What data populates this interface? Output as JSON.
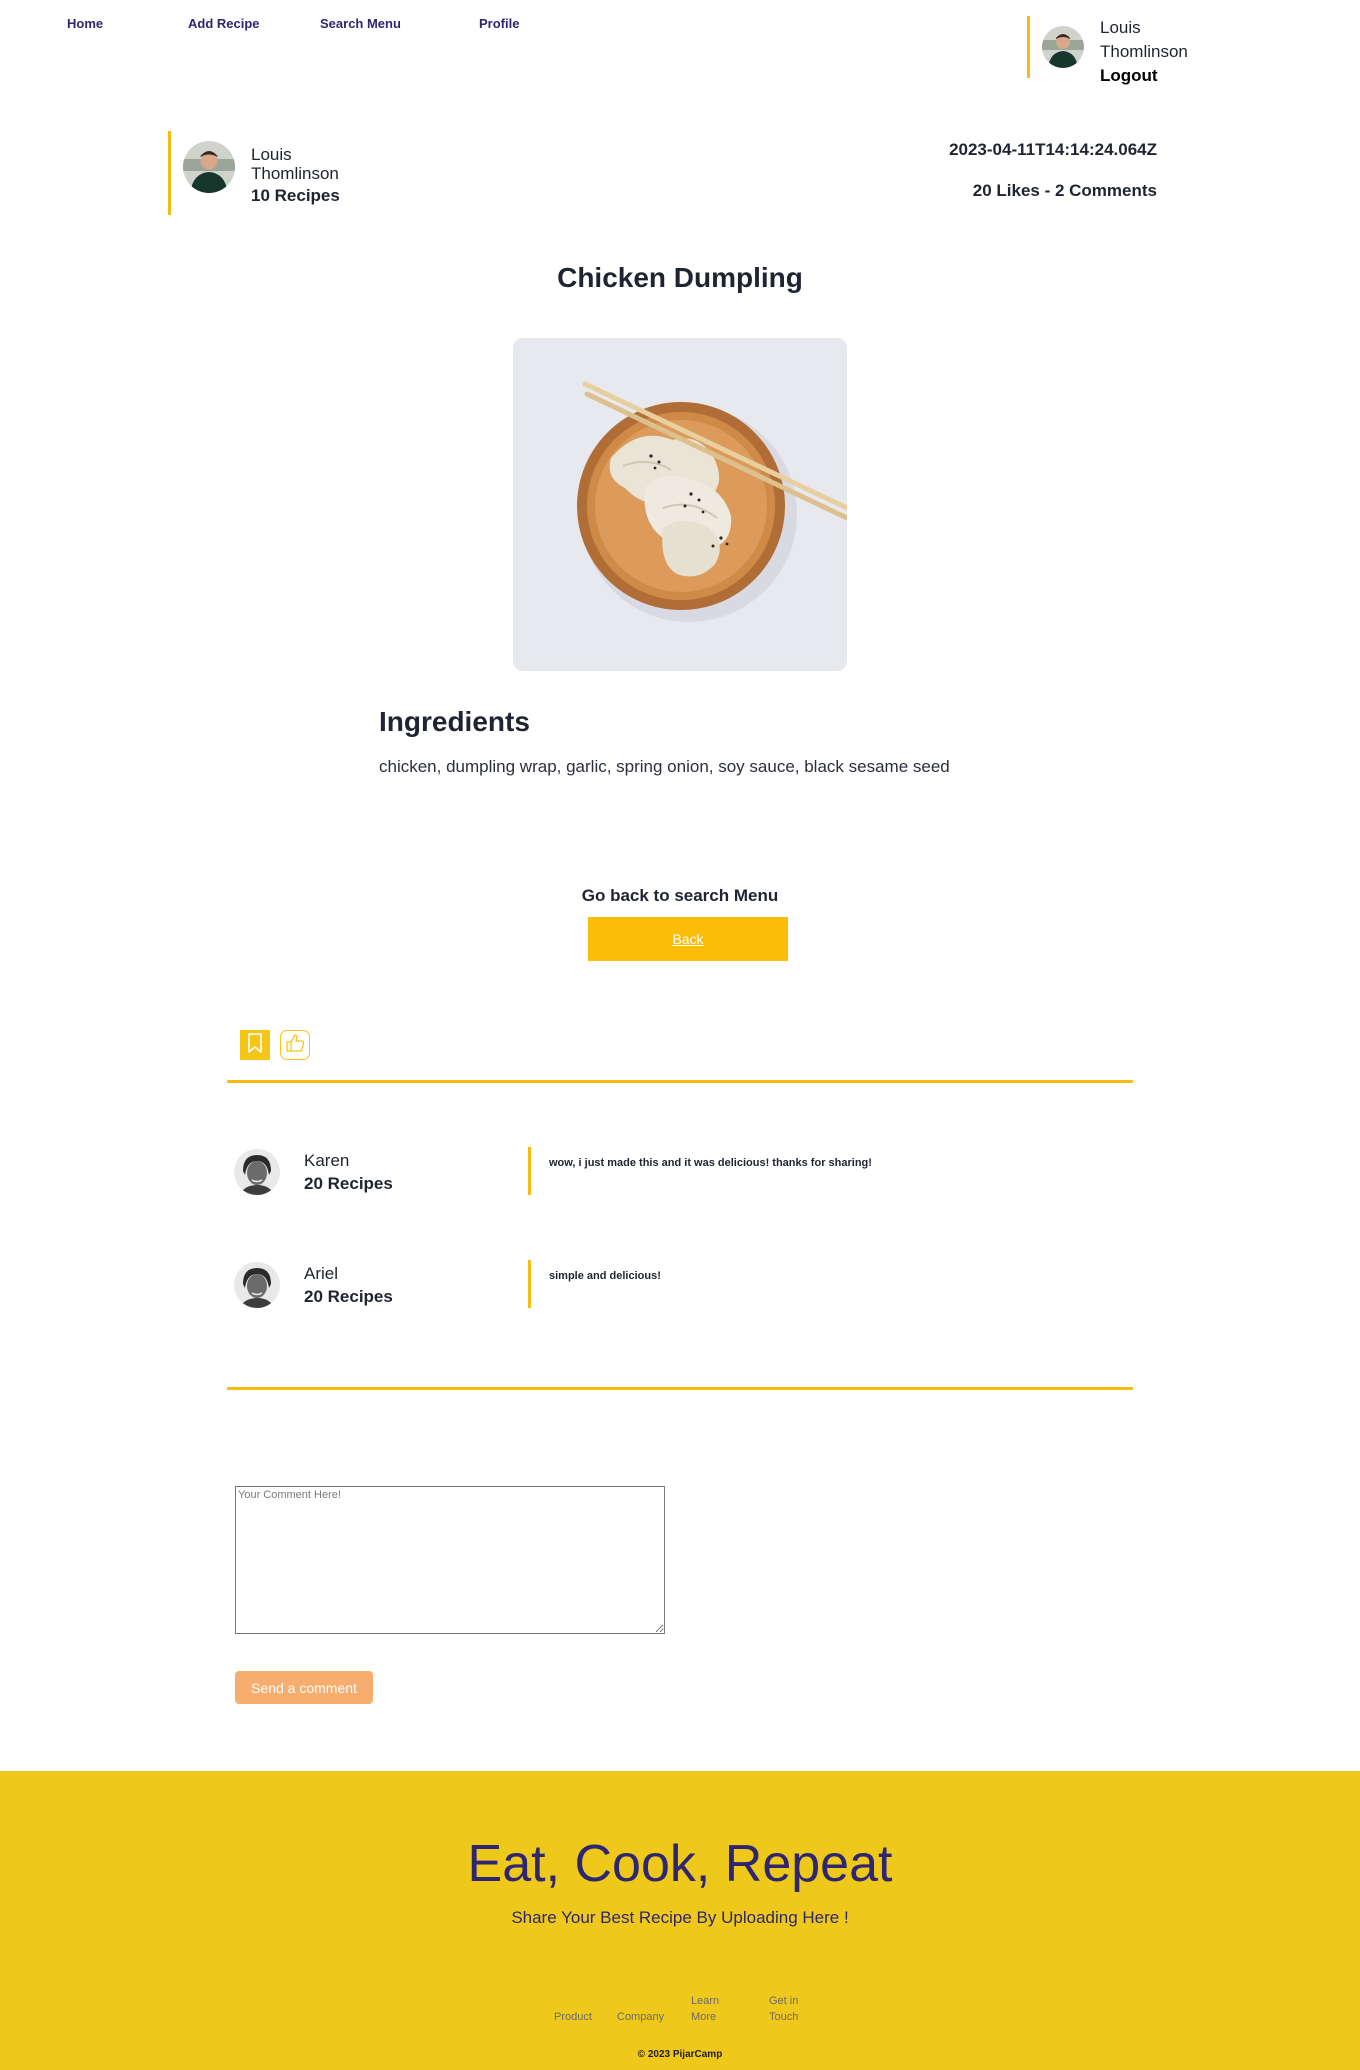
{
  "nav": {
    "links": [
      "Home",
      "Add Recipe",
      "Search Menu",
      "Profile"
    ],
    "user": {
      "first_name": "Louis",
      "last_name": "Thomlinson",
      "logout": "Logout"
    }
  },
  "author": {
    "first_name": "Louis",
    "last_name": "Thomlinson",
    "recipes": "10 Recipes"
  },
  "meta": {
    "date": "2023-04-11T14:14:24.064Z",
    "stats": "20 Likes - 2 Comments"
  },
  "recipe": {
    "title": "Chicken Dumpling",
    "ingredients_heading": "Ingredients",
    "ingredients": "chicken, dumpling wrap, garlic, spring onion, soy sauce, black sesame seed"
  },
  "back": {
    "caption": "Go back to search Menu",
    "button": "Back"
  },
  "actions": {
    "bookmark_icon": "bookmark-icon",
    "like_icon": "thumbs-up-icon"
  },
  "comments": [
    {
      "name": "Karen",
      "recipes": "20 Recipes",
      "text": "wow, i just made this and it was delicious! thanks for sharing!"
    },
    {
      "name": "Ariel",
      "recipes": "20 Recipes",
      "text": "simple and delicious!"
    }
  ],
  "comment_form": {
    "placeholder": "Your Comment Here!",
    "send": "Send a comment"
  },
  "footer": {
    "title": "Eat, Cook, Repeat",
    "subtitle": "Share Your Best Recipe By Uploading Here !",
    "links": [
      "Product",
      "Company",
      "Learn More",
      "Get in Touch"
    ],
    "copyright": "© 2023 PijarCamp"
  },
  "colors": {
    "accent": "#f5bd0f",
    "footer_bg": "#efc81c",
    "nav_text": "#2e266f",
    "send_button": "#f7ad6d",
    "back_button": "#fbbd08"
  }
}
